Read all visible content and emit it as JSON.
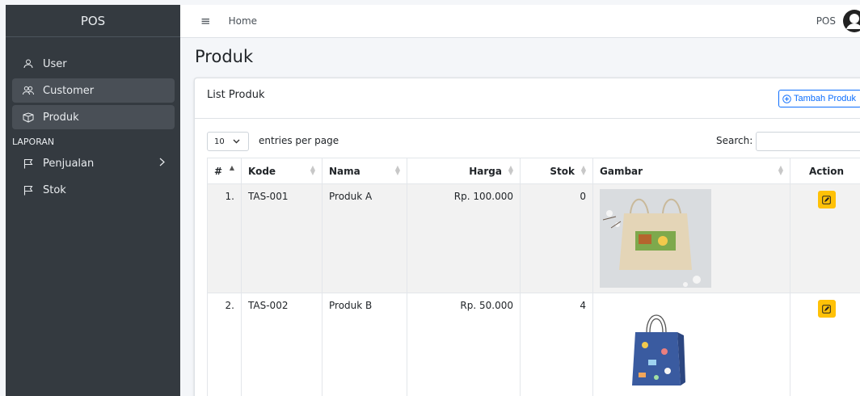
{
  "sidebar": {
    "brand": "POS",
    "items": [
      {
        "label": "User",
        "icon": "user-icon"
      },
      {
        "label": "Customer",
        "icon": "users-icon"
      },
      {
        "label": "Produk",
        "icon": "box-icon"
      }
    ],
    "section_header": "LAPORAN",
    "report_items": [
      {
        "label": "Penjualan",
        "icon": "flag-icon"
      },
      {
        "label": "Stok",
        "icon": "flag-icon"
      }
    ]
  },
  "navbar": {
    "home": "Home",
    "user": "POS"
  },
  "page": {
    "title": "Produk"
  },
  "card": {
    "title": "List Produk",
    "add_button": "Tambah Produk"
  },
  "table_controls": {
    "entries_value": "10",
    "entries_label": "entries per page",
    "search_label": "Search:"
  },
  "table": {
    "headers": [
      "#",
      "Kode",
      "Nama",
      "Harga",
      "Stok",
      "Gambar",
      "Action"
    ],
    "rows": [
      {
        "no": "1.",
        "kode": "TAS-001",
        "nama": "Produk A",
        "harga": "Rp. 100.000",
        "stok": "0"
      },
      {
        "no": "2.",
        "kode": "TAS-002",
        "nama": "Produk B",
        "harga": "Rp. 50.000",
        "stok": "4"
      }
    ]
  },
  "colors": {
    "sidebar_bg": "#343a40",
    "primary": "#0d6efd",
    "warning": "#ffc107"
  }
}
